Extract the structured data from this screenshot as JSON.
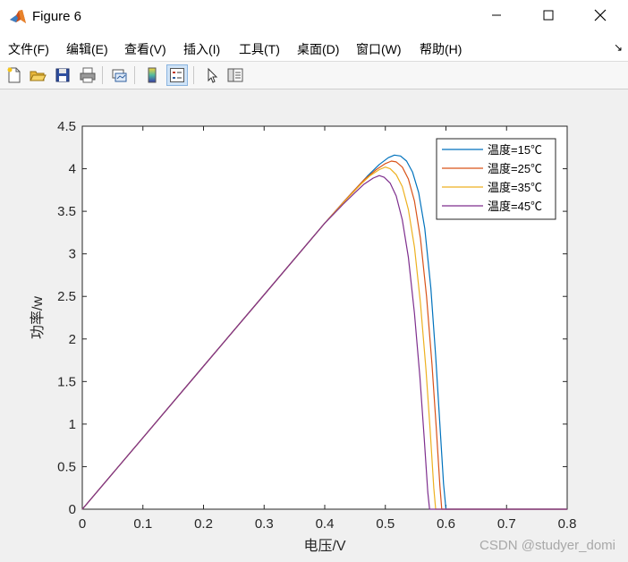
{
  "window": {
    "title": "Figure 6",
    "minimize_icon": "minimize-icon",
    "maximize_icon": "maximize-icon",
    "close_icon": "close-icon"
  },
  "menu": {
    "items": [
      "文件(F)",
      "编辑(E)",
      "查看(V)",
      "插入(I)",
      "工具(T)",
      "桌面(D)",
      "窗口(W)",
      "帮助(H)"
    ],
    "corner_glyph": "↘"
  },
  "toolbar": {
    "icons": [
      "new-figure-icon",
      "open-file-icon",
      "save-icon",
      "print-icon",
      "link-plot-icon",
      "colorbar-icon",
      "legend-icon",
      "pointer-icon",
      "property-inspector-icon"
    ],
    "active": "legend-icon"
  },
  "watermark": "CSDN @studyer_domi",
  "chart_data": {
    "type": "line",
    "xlabel": "电压/V",
    "ylabel": "功率/w",
    "xlim": [
      0,
      0.8
    ],
    "ylim": [
      0,
      4.5
    ],
    "xticks": [
      0,
      0.1,
      0.2,
      0.3,
      0.4,
      0.5,
      0.6,
      0.7,
      0.8
    ],
    "xtick_labels": [
      "0",
      "0.1",
      "0.2",
      "0.3",
      "0.4",
      "0.5",
      "0.6",
      "0.7",
      "0.8"
    ],
    "yticks": [
      0,
      0.5,
      1,
      1.5,
      2,
      2.5,
      3,
      3.5,
      4,
      4.5
    ],
    "ytick_labels": [
      "0",
      "0.5",
      "1",
      "1.5",
      "2",
      "2.5",
      "3",
      "3.5",
      "4",
      "4.5"
    ],
    "grid": false,
    "legend_position": "top-right",
    "series": [
      {
        "name": "温度=15℃",
        "color": "#0072BD",
        "points": [
          [
            0,
            0
          ],
          [
            0.1,
            0.84
          ],
          [
            0.2,
            1.68
          ],
          [
            0.3,
            2.52
          ],
          [
            0.4,
            3.36
          ],
          [
            0.44,
            3.68
          ],
          [
            0.47,
            3.91
          ],
          [
            0.49,
            4.05
          ],
          [
            0.505,
            4.13
          ],
          [
            0.515,
            4.16
          ],
          [
            0.525,
            4.15
          ],
          [
            0.535,
            4.09
          ],
          [
            0.545,
            3.96
          ],
          [
            0.555,
            3.72
          ],
          [
            0.565,
            3.3
          ],
          [
            0.575,
            2.6
          ],
          [
            0.583,
            1.8
          ],
          [
            0.59,
            1.0
          ],
          [
            0.596,
            0.3
          ],
          [
            0.6,
            0
          ],
          [
            0.8,
            0
          ]
        ]
      },
      {
        "name": "温度=25℃",
        "color": "#D95319",
        "points": [
          [
            0,
            0
          ],
          [
            0.1,
            0.84
          ],
          [
            0.2,
            1.68
          ],
          [
            0.3,
            2.52
          ],
          [
            0.4,
            3.36
          ],
          [
            0.44,
            3.68
          ],
          [
            0.465,
            3.87
          ],
          [
            0.485,
            3.99
          ],
          [
            0.5,
            4.06
          ],
          [
            0.51,
            4.09
          ],
          [
            0.518,
            4.08
          ],
          [
            0.528,
            4.02
          ],
          [
            0.538,
            3.88
          ],
          [
            0.548,
            3.62
          ],
          [
            0.558,
            3.18
          ],
          [
            0.568,
            2.5
          ],
          [
            0.577,
            1.7
          ],
          [
            0.584,
            0.95
          ],
          [
            0.59,
            0.28
          ],
          [
            0.593,
            0
          ],
          [
            0.8,
            0
          ]
        ]
      },
      {
        "name": "温度=35℃",
        "color": "#EDB120",
        "points": [
          [
            0,
            0
          ],
          [
            0.1,
            0.84
          ],
          [
            0.2,
            1.68
          ],
          [
            0.3,
            2.52
          ],
          [
            0.4,
            3.36
          ],
          [
            0.44,
            3.67
          ],
          [
            0.46,
            3.82
          ],
          [
            0.475,
            3.92
          ],
          [
            0.49,
            3.99
          ],
          [
            0.5,
            4.02
          ],
          [
            0.508,
            4.0
          ],
          [
            0.518,
            3.93
          ],
          [
            0.528,
            3.79
          ],
          [
            0.538,
            3.52
          ],
          [
            0.548,
            3.08
          ],
          [
            0.558,
            2.42
          ],
          [
            0.567,
            1.65
          ],
          [
            0.574,
            0.92
          ],
          [
            0.58,
            0.25
          ],
          [
            0.583,
            0
          ],
          [
            0.8,
            0
          ]
        ]
      },
      {
        "name": "温度=45℃",
        "color": "#7E2F8E",
        "points": [
          [
            0,
            0
          ],
          [
            0.1,
            0.84
          ],
          [
            0.2,
            1.68
          ],
          [
            0.3,
            2.52
          ],
          [
            0.4,
            3.36
          ],
          [
            0.43,
            3.58
          ],
          [
            0.45,
            3.72
          ],
          [
            0.465,
            3.82
          ],
          [
            0.48,
            3.89
          ],
          [
            0.49,
            3.92
          ],
          [
            0.498,
            3.9
          ],
          [
            0.508,
            3.83
          ],
          [
            0.518,
            3.68
          ],
          [
            0.528,
            3.4
          ],
          [
            0.538,
            2.96
          ],
          [
            0.548,
            2.3
          ],
          [
            0.557,
            1.55
          ],
          [
            0.564,
            0.85
          ],
          [
            0.57,
            0.2
          ],
          [
            0.573,
            0
          ],
          [
            0.8,
            0
          ]
        ]
      }
    ]
  }
}
